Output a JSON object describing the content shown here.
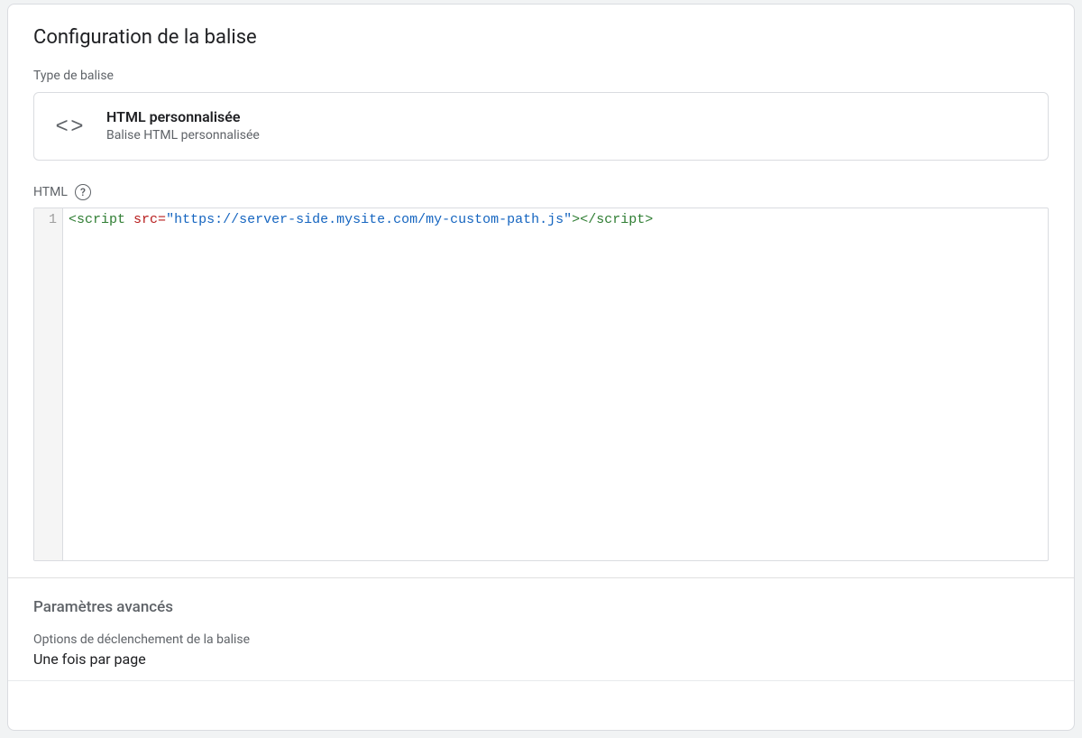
{
  "header": {
    "title": "Configuration de la balise"
  },
  "tag_type": {
    "label": "Type de balise",
    "icon_name": "code-icon",
    "name": "HTML personnalisée",
    "desc": "Balise HTML personnalisée"
  },
  "html_editor": {
    "label": "HTML",
    "help_glyph": "?",
    "line_number": "1",
    "code_tokens": {
      "open_tag": "<script",
      "space1": " ",
      "attr_name": "src",
      "eq": "=",
      "quote_open": "\"",
      "attr_value": "https://server-side.mysite.com/my-custom-path.js",
      "quote_close": "\"",
      "open_tag_end": ">",
      "close_tag": "</scr",
      "close_tag_suffix": "ipt>"
    }
  },
  "advanced": {
    "title": "Paramètres avancés",
    "trigger_option_label": "Options de déclenchement de la balise",
    "trigger_option_value": "Une fois par page"
  }
}
